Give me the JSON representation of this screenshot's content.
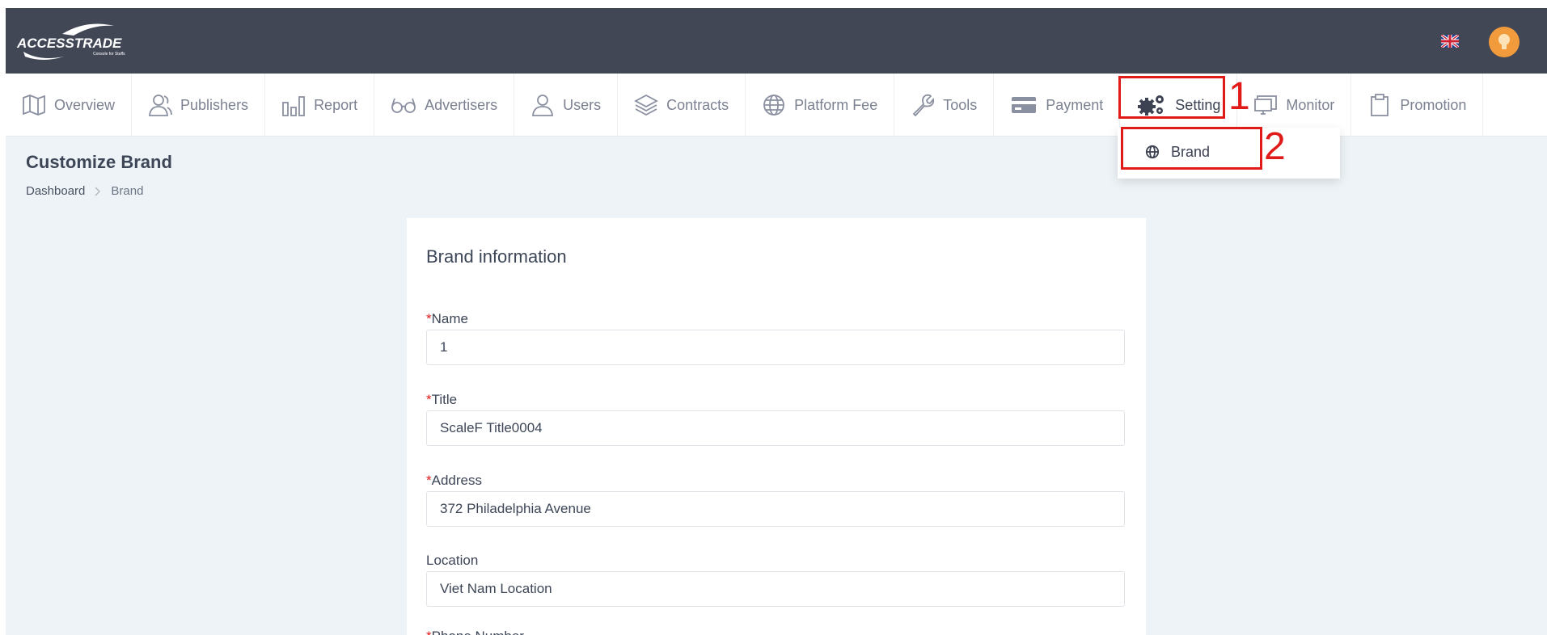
{
  "header": {
    "logo_text": "ACCESSTRADE",
    "logo_subtext": "Console for Staffs",
    "flag": "uk-flag-icon",
    "avatar": "user-avatar"
  },
  "nav": {
    "items": [
      {
        "label": "Overview",
        "icon": "map-icon"
      },
      {
        "label": "Publishers",
        "icon": "users-icon"
      },
      {
        "label": "Report",
        "icon": "bar-chart-icon"
      },
      {
        "label": "Advertisers",
        "icon": "glasses-icon"
      },
      {
        "label": "Users",
        "icon": "user-icon"
      },
      {
        "label": "Contracts",
        "icon": "layers-icon"
      },
      {
        "label": "Platform Fee",
        "icon": "globe-icon"
      },
      {
        "label": "Tools",
        "icon": "wrench-icon"
      },
      {
        "label": "Payment",
        "icon": "credit-card-icon"
      },
      {
        "label": "Setting",
        "icon": "gears-icon"
      },
      {
        "label": "Monitor",
        "icon": "monitor-icon"
      },
      {
        "label": "Promotion",
        "icon": "clipboard-icon"
      }
    ]
  },
  "dropdown": {
    "items": [
      {
        "label": "Brand",
        "icon": "globe-icon"
      }
    ]
  },
  "annotations": {
    "mark1": "1",
    "mark2": "2",
    "color": "#e01919"
  },
  "page": {
    "title": "Customize Brand",
    "breadcrumb": {
      "root": "Dashboard",
      "current": "Brand"
    }
  },
  "form": {
    "title": "Brand information",
    "fields": [
      {
        "label": "Name",
        "required": true,
        "value": "1"
      },
      {
        "label": "Title",
        "required": true,
        "value": "ScaleF Title0004"
      },
      {
        "label": "Address",
        "required": true,
        "value": "372  Philadelphia Avenue"
      },
      {
        "label": "Location",
        "required": false,
        "value": "Viet Nam Location"
      },
      {
        "label": "Phone Number",
        "required": true,
        "value": ""
      }
    ]
  },
  "colors": {
    "topbar": "#424756",
    "background": "#edf3f6",
    "accent": "#f29b3c",
    "required": "#e01919"
  }
}
